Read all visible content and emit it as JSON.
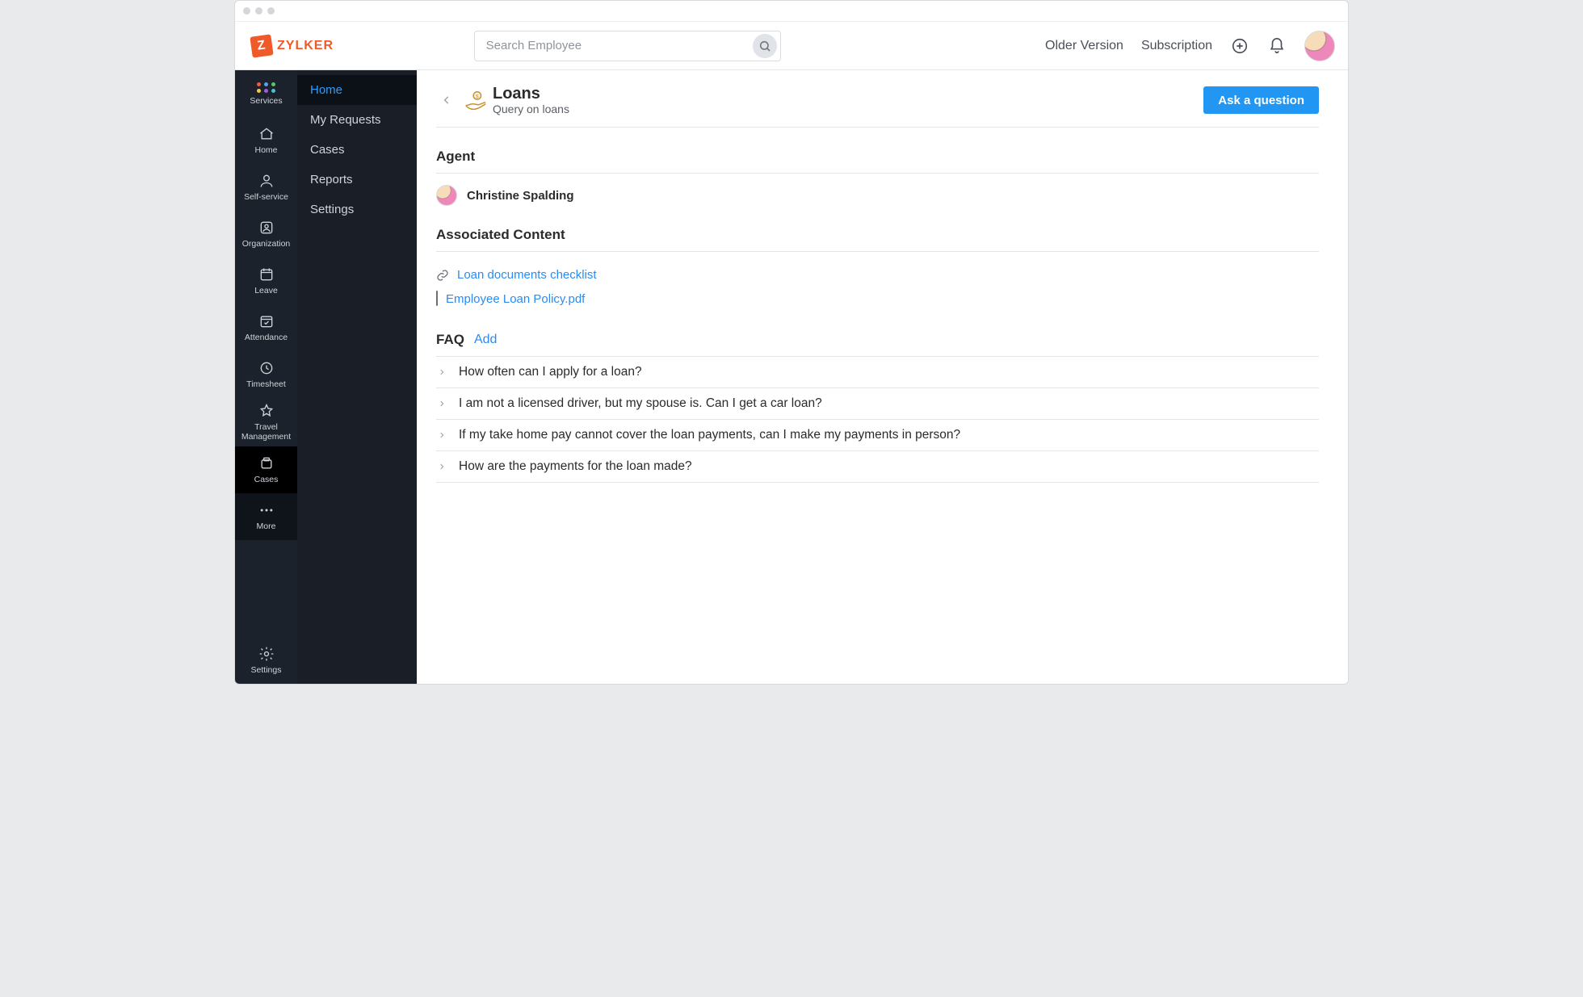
{
  "brand": {
    "name": "ZYLKER",
    "mark_letter": "Z"
  },
  "header": {
    "search_placeholder": "Search Employee",
    "links": {
      "older_version": "Older Version",
      "subscription": "Subscription"
    }
  },
  "rail": {
    "items": [
      {
        "id": "services",
        "label": "Services"
      },
      {
        "id": "home",
        "label": "Home"
      },
      {
        "id": "self-service",
        "label": "Self-service"
      },
      {
        "id": "organization",
        "label": "Organization"
      },
      {
        "id": "leave",
        "label": "Leave"
      },
      {
        "id": "attendance",
        "label": "Attendance"
      },
      {
        "id": "timesheet",
        "label": "Timesheet"
      },
      {
        "id": "travel",
        "label": "Travel Management"
      },
      {
        "id": "cases",
        "label": "Cases"
      },
      {
        "id": "more",
        "label": "More"
      }
    ],
    "footer": {
      "id": "settings",
      "label": "Settings"
    }
  },
  "subnav": {
    "items": [
      {
        "id": "home",
        "label": "Home",
        "active": true
      },
      {
        "id": "my-requests",
        "label": "My Requests"
      },
      {
        "id": "cases",
        "label": "Cases"
      },
      {
        "id": "reports",
        "label": "Reports"
      },
      {
        "id": "settings",
        "label": "Settings"
      }
    ]
  },
  "page": {
    "title": "Loans",
    "subtitle": "Query on loans",
    "ask_label": "Ask a question"
  },
  "agent_section": {
    "heading": "Agent",
    "name": "Christine Spalding"
  },
  "associated_section": {
    "heading": "Associated Content",
    "items": [
      {
        "icon": "link",
        "label": "Loan documents checklist"
      },
      {
        "icon": "file",
        "label": "Employee Loan Policy.pdf"
      }
    ]
  },
  "faq_section": {
    "heading": "FAQ",
    "add_label": "Add",
    "items": [
      "How often can I apply for a loan?",
      "I am not a licensed driver, but my spouse is. Can I get a car loan?",
      "If my take home pay cannot cover the loan payments, can I make my payments in person?",
      "How are the payments for the loan made?"
    ]
  }
}
